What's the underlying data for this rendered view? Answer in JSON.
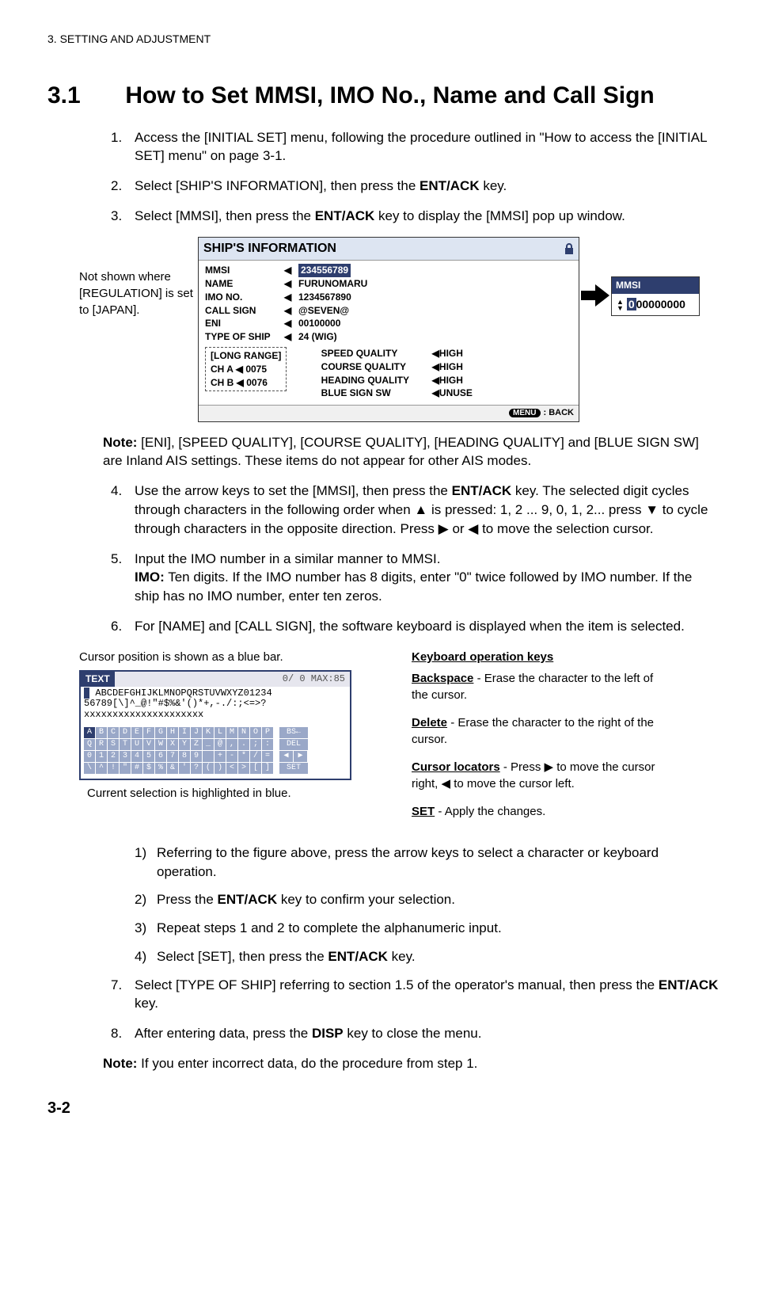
{
  "header": "3.  SETTING AND ADJUSTMENT",
  "section_number": "3.1",
  "section_title": "How to Set MMSI, IMO No., Name and Call Sign",
  "steps": {
    "s1": "Access the [INITIAL SET] menu, following the procedure outlined in \"How to access the [INITIAL SET] menu\" on page 3-1.",
    "s2a": "Select [SHIP'S INFORMATION], then press the ",
    "s2b": "ENT/ACK",
    "s2c": " key.",
    "s3a": "Select [MMSI], then press the ",
    "s3b": "ENT/ACK",
    "s3c": " key to display the [MMSI] pop up window.",
    "s4a": " Use the arrow keys to set the [MMSI], then press the ",
    "s4b": "ENT/ACK",
    "s4c": " key. The selected digit cycles through characters in the following order when ▲ is pressed: 1, 2 ... 9, 0, 1, 2... press ▼ to cycle through characters in the opposite direction. Press ▶ or ◀ to move the selection cursor.",
    "s5a": "Input the IMO number in a similar manner to MMSI.",
    "s5b": "IMO:",
    "s5c": " Ten digits. If the IMO number has 8 digits, enter \"0\" twice followed by IMO number. If the ship has no IMO number, enter ten zeros.",
    "s6": "For [NAME] and [CALL SIGN], the software keyboard is displayed when the item is selected.",
    "s7a": "Select [TYPE OF SHIP] referring to section 1.5 of the operator's manual, then press the ",
    "s7b": "ENT/ACK",
    "s7c": " key.",
    "s8a": "After entering data, press the ",
    "s8b": "DISP",
    "s8c": " key to close the menu."
  },
  "side_note": "Not shown where [REGULATION] is set to [JAPAN].",
  "ship": {
    "title": "SHIP'S INFORMATION",
    "rows": [
      {
        "label": "MMSI",
        "val": "234556789",
        "hl": true
      },
      {
        "label": "NAME",
        "val": "FURUNOMARU"
      },
      {
        "label": "IMO NO.",
        "val": "1234567890"
      },
      {
        "label": "CALL SIGN",
        "val": "@SEVEN@"
      },
      {
        "label": "ENI",
        "val": "00100000"
      },
      {
        "label": "TYPE OF SHIP",
        "val": "24    (WIG)"
      }
    ],
    "long_range": {
      "title": "[LONG RANGE]",
      "cha": "CH A   ◀  0075",
      "chb": "CH B   ◀  0076"
    },
    "quality": [
      {
        "label": "SPEED QUALITY",
        "val": "HIGH"
      },
      {
        "label": "COURSE QUALITY",
        "val": "HIGH"
      },
      {
        "label": "HEADING QUALITY",
        "val": "HIGH"
      },
      {
        "label": "BLUE SIGN SW",
        "val": "UNUSE"
      }
    ],
    "footer_menu": "MENU",
    "footer_back": ": BACK"
  },
  "mmsi_popup": {
    "title": "MMSI",
    "digit_hl": "0",
    "rest": "00000000"
  },
  "note1a": "Note:",
  "note1b": " [ENI], [SPEED QUALITY], [COURSE QUALITY], [HEADING QUALITY] and [BLUE SIGN SW] are Inland AIS settings. These items do not appear for other AIS modes.",
  "kbd": {
    "cursor_caption": "Cursor position is shown as a blue bar.",
    "text_label": "TEXT",
    "counter": "0/ 0 MAX:85",
    "line1": " ABCDEFGHIJKLMNOPQRSTUVWXYZ01234",
    "line2": "56789[\\]^_@!\"#$%&'()*+,-./:;<=>?",
    "line3": "xxxxxxxxxxxxxxxxxxxxx",
    "row1": "ABCDEFGHIJKLMNOP",
    "row2": "QRSTUVWXYZ_@,.;:",
    "row3": "0123456789 +-*/=",
    "row4": "\\^!\"#$%&'?()<>[]",
    "op_bs": "BS←",
    "op_del": "DEL",
    "op_left": "◀",
    "op_right": "▶",
    "op_set": "SET",
    "current_caption": "Current selection is highlighted in blue.",
    "right_head": "Keyboard operation keys",
    "bs_head": "Backspace",
    "bs_text": " - Erase the character to the left of the cursor.",
    "del_head": "Delete",
    "del_text": " - Erase the character to the right of the cursor.",
    "cur_head": "Cursor locators",
    "cur_text": " - Press ▶ to move the cursor right, ◀ to move the cursor left.",
    "set_head": "SET",
    "set_text": " - Apply the changes."
  },
  "substeps": {
    "ss1": "Referring to the figure above, press the arrow keys to select a character or keyboard operation.",
    "ss2a": "Press the ",
    "ss2b": "ENT/ACK",
    "ss2c": " key to confirm your selection.",
    "ss3": "Repeat steps 1 and 2 to complete the alphanumeric input.",
    "ss4a": "Select [SET], then press the ",
    "ss4b": "ENT/ACK",
    "ss4c": " key."
  },
  "note2a": "Note:",
  "note2b": " If you enter incorrect data, do the procedure from step 1.",
  "page_number": "3-2"
}
